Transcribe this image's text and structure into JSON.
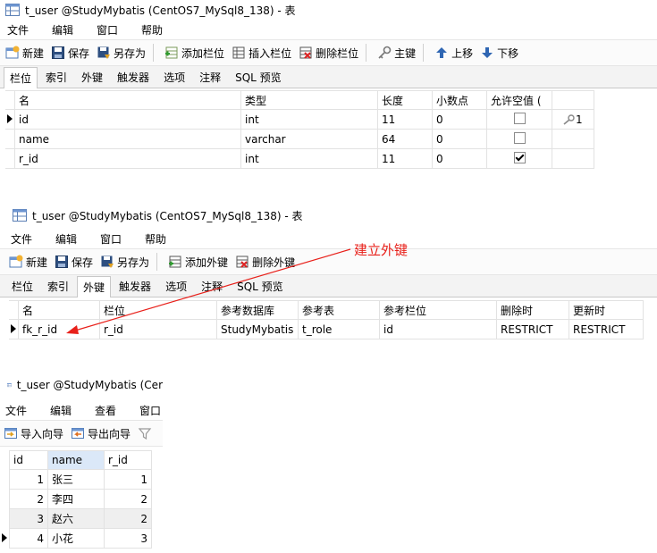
{
  "panel1": {
    "title": "t_user @StudyMybatis (CentOS7_MySql8_138) - 表",
    "menu": [
      "文件",
      "编辑",
      "窗口",
      "帮助"
    ],
    "toolbar": {
      "new": "新建",
      "save": "保存",
      "saveas": "另存为",
      "add_field": "添加栏位",
      "insert_field": "插入栏位",
      "delete_field": "删除栏位",
      "primary_key": "主键",
      "move_up": "上移",
      "move_down": "下移"
    },
    "tabs": [
      "栏位",
      "索引",
      "外键",
      "触发器",
      "选项",
      "注释",
      "SQL 预览"
    ],
    "columns": [
      "名",
      "类型",
      "长度",
      "小数点",
      "允许空值 ("
    ],
    "rows": [
      {
        "name": "id",
        "type": "int",
        "length": "11",
        "decimals": "0",
        "nullable": false,
        "key": "1"
      },
      {
        "name": "name",
        "type": "varchar",
        "length": "64",
        "decimals": "0",
        "nullable": false,
        "key": ""
      },
      {
        "name": "r_id",
        "type": "int",
        "length": "11",
        "decimals": "0",
        "nullable": true,
        "key": ""
      }
    ]
  },
  "panel2": {
    "title": "t_user @StudyMybatis (CentOS7_MySql8_138) - 表",
    "menu": [
      "文件",
      "编辑",
      "窗口",
      "帮助"
    ],
    "toolbar": {
      "new": "新建",
      "save": "保存",
      "saveas": "另存为",
      "add_fk": "添加外键",
      "delete_fk": "删除外键"
    },
    "tabs": [
      "栏位",
      "索引",
      "外键",
      "触发器",
      "选项",
      "注释",
      "SQL 预览"
    ],
    "columns": [
      "名",
      "栏位",
      "参考数据库",
      "参考表",
      "参考栏位",
      "删除时",
      "更新时"
    ],
    "rows": [
      {
        "name": "fk_r_id",
        "field": "r_id",
        "ref_db": "StudyMybatis",
        "ref_table": "t_role",
        "ref_field": "id",
        "on_delete": "RESTRICT",
        "on_update": "RESTRICT"
      }
    ]
  },
  "annotation": "建立外键",
  "panel3": {
    "title": "t_user @StudyMybatis (Cer",
    "menu": [
      "文件",
      "编辑",
      "查看",
      "窗口"
    ],
    "toolbar": {
      "import": "导入向导",
      "export": "导出向导"
    },
    "columns": [
      "id",
      "name",
      "r_id"
    ],
    "rows": [
      {
        "id": "1",
        "name": "张三",
        "r_id": "1"
      },
      {
        "id": "2",
        "name": "李四",
        "r_id": "2"
      },
      {
        "id": "3",
        "name": "赵六",
        "r_id": "2"
      },
      {
        "id": "4",
        "name": "小花",
        "r_id": "3"
      }
    ]
  },
  "colors": {
    "annotation": "#e8201a",
    "header_highlight": "#dbe8f8"
  }
}
